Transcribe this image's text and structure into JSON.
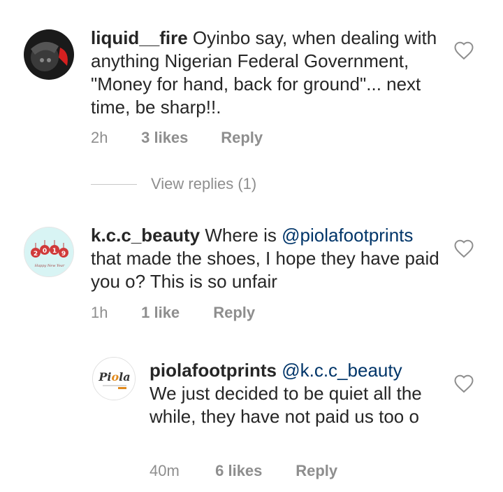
{
  "comments": [
    {
      "username": "liquid__fire",
      "text": " Oyinbo say, when dealing with anything Nigerian Federal Government, \"Money for hand, back for ground\"... next time, be sharp!!.",
      "time": "2h",
      "likes": "3 likes",
      "reply": "Reply"
    },
    {
      "username": "k.c.c_beauty",
      "text_before": " Where is ",
      "mention": "@piolafootprints",
      "text_after": " that made the shoes, I hope they have paid you o? This is so unfair",
      "time": "1h",
      "likes": "1 like",
      "reply": "Reply",
      "avatar_text": "2019",
      "avatar_sub": "Happy New Year"
    }
  ],
  "view_replies": "View replies (1)",
  "reply_comment": {
    "username": "piolafootprints",
    "mention": "@k.c.c_beauty",
    "text": "We just decided to be quiet all the while, they have not paid us too o",
    "time": "40m",
    "likes": "6 likes",
    "reply": "Reply",
    "avatar_text": "Piola"
  },
  "colors": {
    "text": "#262626",
    "meta": "#8e8e8e",
    "mention": "#003569"
  }
}
